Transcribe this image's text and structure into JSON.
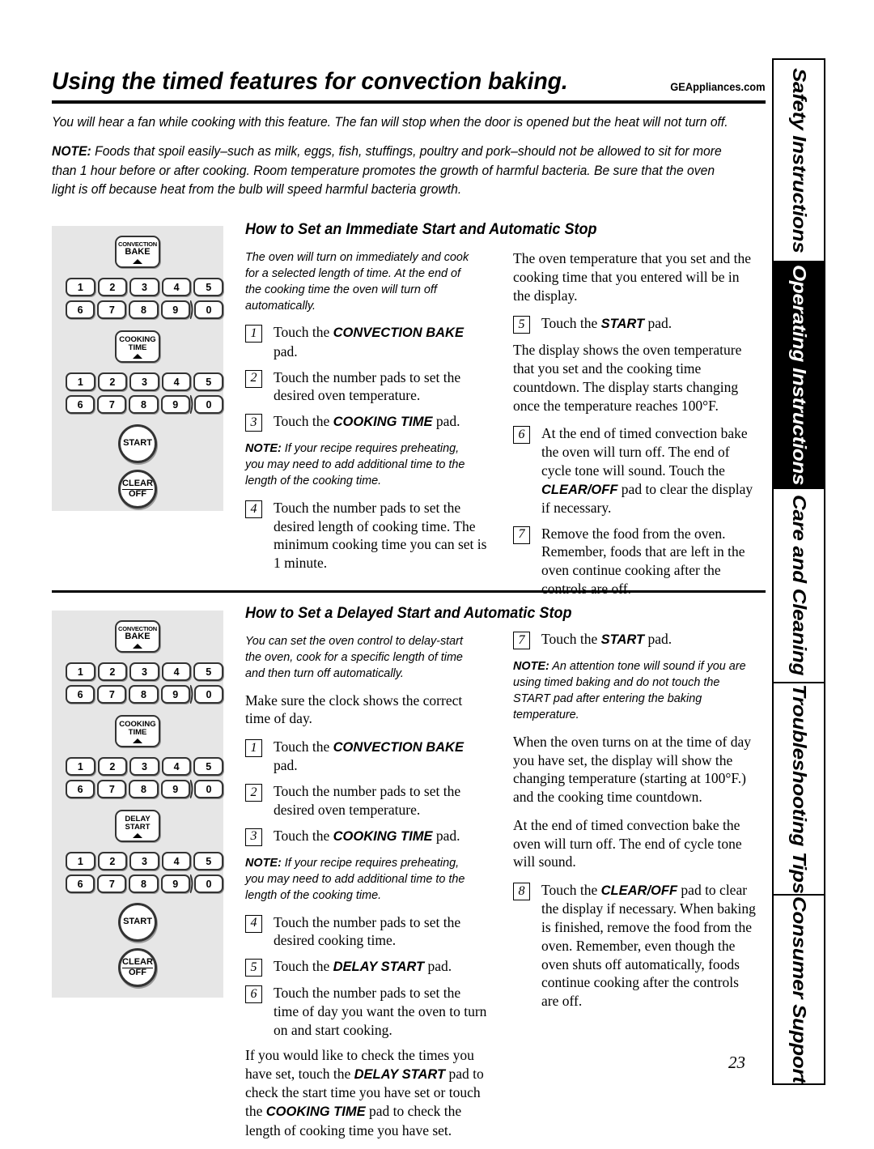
{
  "header": {
    "title": "Using the timed features for convection baking.",
    "site_url": "GEAppliances.com"
  },
  "intro": {
    "paragraph1": "You will hear a fan while cooking with this feature. The fan will stop when the door is opened but the heat will not turn off.",
    "note_label": "NOTE:",
    "note_text": " Foods that spoil easily–such as milk, eggs, fish, stuffings, poultry and pork–should not be allowed to sit for more than 1 hour before or after cooking. Room temperature promotes the growth of harmful bacteria. Be sure that the oven light is off because heat from the bulb will speed harmful bacteria growth."
  },
  "side_tabs": [
    {
      "label": "Safety Instructions",
      "active": false
    },
    {
      "label": "Operating Instructions",
      "active": true
    },
    {
      "label": "Care and Cleaning",
      "active": false
    },
    {
      "label": "Troubleshooting Tips",
      "active": false
    },
    {
      "label": "Consumer Support",
      "active": false
    }
  ],
  "keypad": {
    "row1": [
      "1",
      "2",
      "3",
      "4",
      "5"
    ],
    "row2": [
      "6",
      "7",
      "8",
      "9",
      "0"
    ],
    "convection_bake_line1": "CONVECTION",
    "convection_bake_line2": "BAKE",
    "cooking_time_line1": "COOKING",
    "cooking_time_line2": "TIME",
    "delay_start_line1": "DELAY",
    "delay_start_line2": "START",
    "start_label": "START",
    "clear_label": "CLEAR",
    "off_label": "OFF"
  },
  "section1": {
    "heading": "How to Set an Immediate Start and Automatic Stop",
    "lede": "The oven will turn on immediately and cook for a selected length of time. At the end of the cooking time the oven will turn off automatically.",
    "steps": [
      {
        "num": "1",
        "pre": "Touch the ",
        "bold": "CONVECTION BAKE",
        "post": " pad."
      },
      {
        "num": "2",
        "pre": "Touch the number pads to set the desired oven temperature.",
        "bold": "",
        "post": ""
      },
      {
        "num": "3",
        "pre": "Touch the ",
        "bold": "COOKING TIME",
        "post": " pad."
      }
    ],
    "note_label": "NOTE:",
    "note_text": " If your recipe requires preheating, you may need to add additional time to the length of the cooking time.",
    "step4": {
      "num": "4",
      "text": "Touch the number pads to set the desired length of cooking time. The minimum cooking time you can set is 1 minute."
    },
    "right_para1": "The oven temperature that you set and the cooking time that you entered will be in the display.",
    "step5": {
      "num": "5",
      "pre": "Touch the ",
      "bold": "START",
      "post": " pad."
    },
    "right_para2": "The display shows the oven temperature that you set and the cooking time countdown. The display starts changing once the temperature reaches 100°F.",
    "step6": {
      "num": "6",
      "pre": "At the end of timed convection bake the oven will turn off. The end of cycle tone will sound. Touch the ",
      "bold": "CLEAR/OFF",
      "post": " pad to clear the display if necessary."
    },
    "step7": {
      "num": "7",
      "text": "Remove the food from the oven. Remember, foods that are left in the oven continue cooking after the controls are off."
    }
  },
  "section2": {
    "heading": "How to Set a Delayed Start and Automatic Stop",
    "lede": "You can set the oven control to delay-start the oven, cook for a specific length of time and then turn off automatically.",
    "clock_para": "Make sure the clock shows the correct time of day.",
    "steps": [
      {
        "num": "1",
        "pre": "Touch the ",
        "bold": "CONVECTION BAKE",
        "post": " pad."
      },
      {
        "num": "2",
        "pre": "Touch the number pads to set the desired oven temperature.",
        "bold": "",
        "post": ""
      },
      {
        "num": "3",
        "pre": "Touch the ",
        "bold": "COOKING TIME",
        "post": " pad."
      }
    ],
    "note_label": "NOTE:",
    "note_text": " If your recipe requires preheating, you may need to add additional time to the length of the cooking time.",
    "step4": {
      "num": "4",
      "text": "Touch the number pads to set the desired cooking time."
    },
    "step5": {
      "num": "5",
      "pre": "Touch the ",
      "bold": "DELAY START",
      "post": " pad."
    },
    "step6": {
      "num": "6",
      "text": "Touch the number pads to set the time of day you want the oven to turn on and start cooking."
    },
    "check_para_p1": "If you would like to check the times you have set, touch the ",
    "check_para_b1": "DELAY START",
    "check_para_p2": " pad to check the start time you have set or touch the ",
    "check_para_b2": "COOKING TIME",
    "check_para_p3": " pad to check the length of cooking time you have set.",
    "step7": {
      "num": "7",
      "pre": "Touch the ",
      "bold": "START",
      "post": " pad."
    },
    "note2_label": "NOTE:",
    "note2_text": " An attention tone will sound if you are using timed baking and do not touch the START pad after entering the baking temperature.",
    "right_para1": "When the oven turns on at the time of day you have set, the display will show the changing temperature (starting at 100°F.) and the cooking time countdown.",
    "right_para2": "At the end of timed convection bake the oven will turn off. The end of cycle tone will sound.",
    "step8": {
      "num": "8",
      "pre": "Touch the ",
      "bold": "CLEAR/OFF",
      "post": " pad to clear the display if necessary. When baking is finished, remove the food from the oven. Remember, even though the oven shuts off automatically, foods continue cooking after the controls are off."
    }
  },
  "footer": {
    "page_number": "23"
  }
}
